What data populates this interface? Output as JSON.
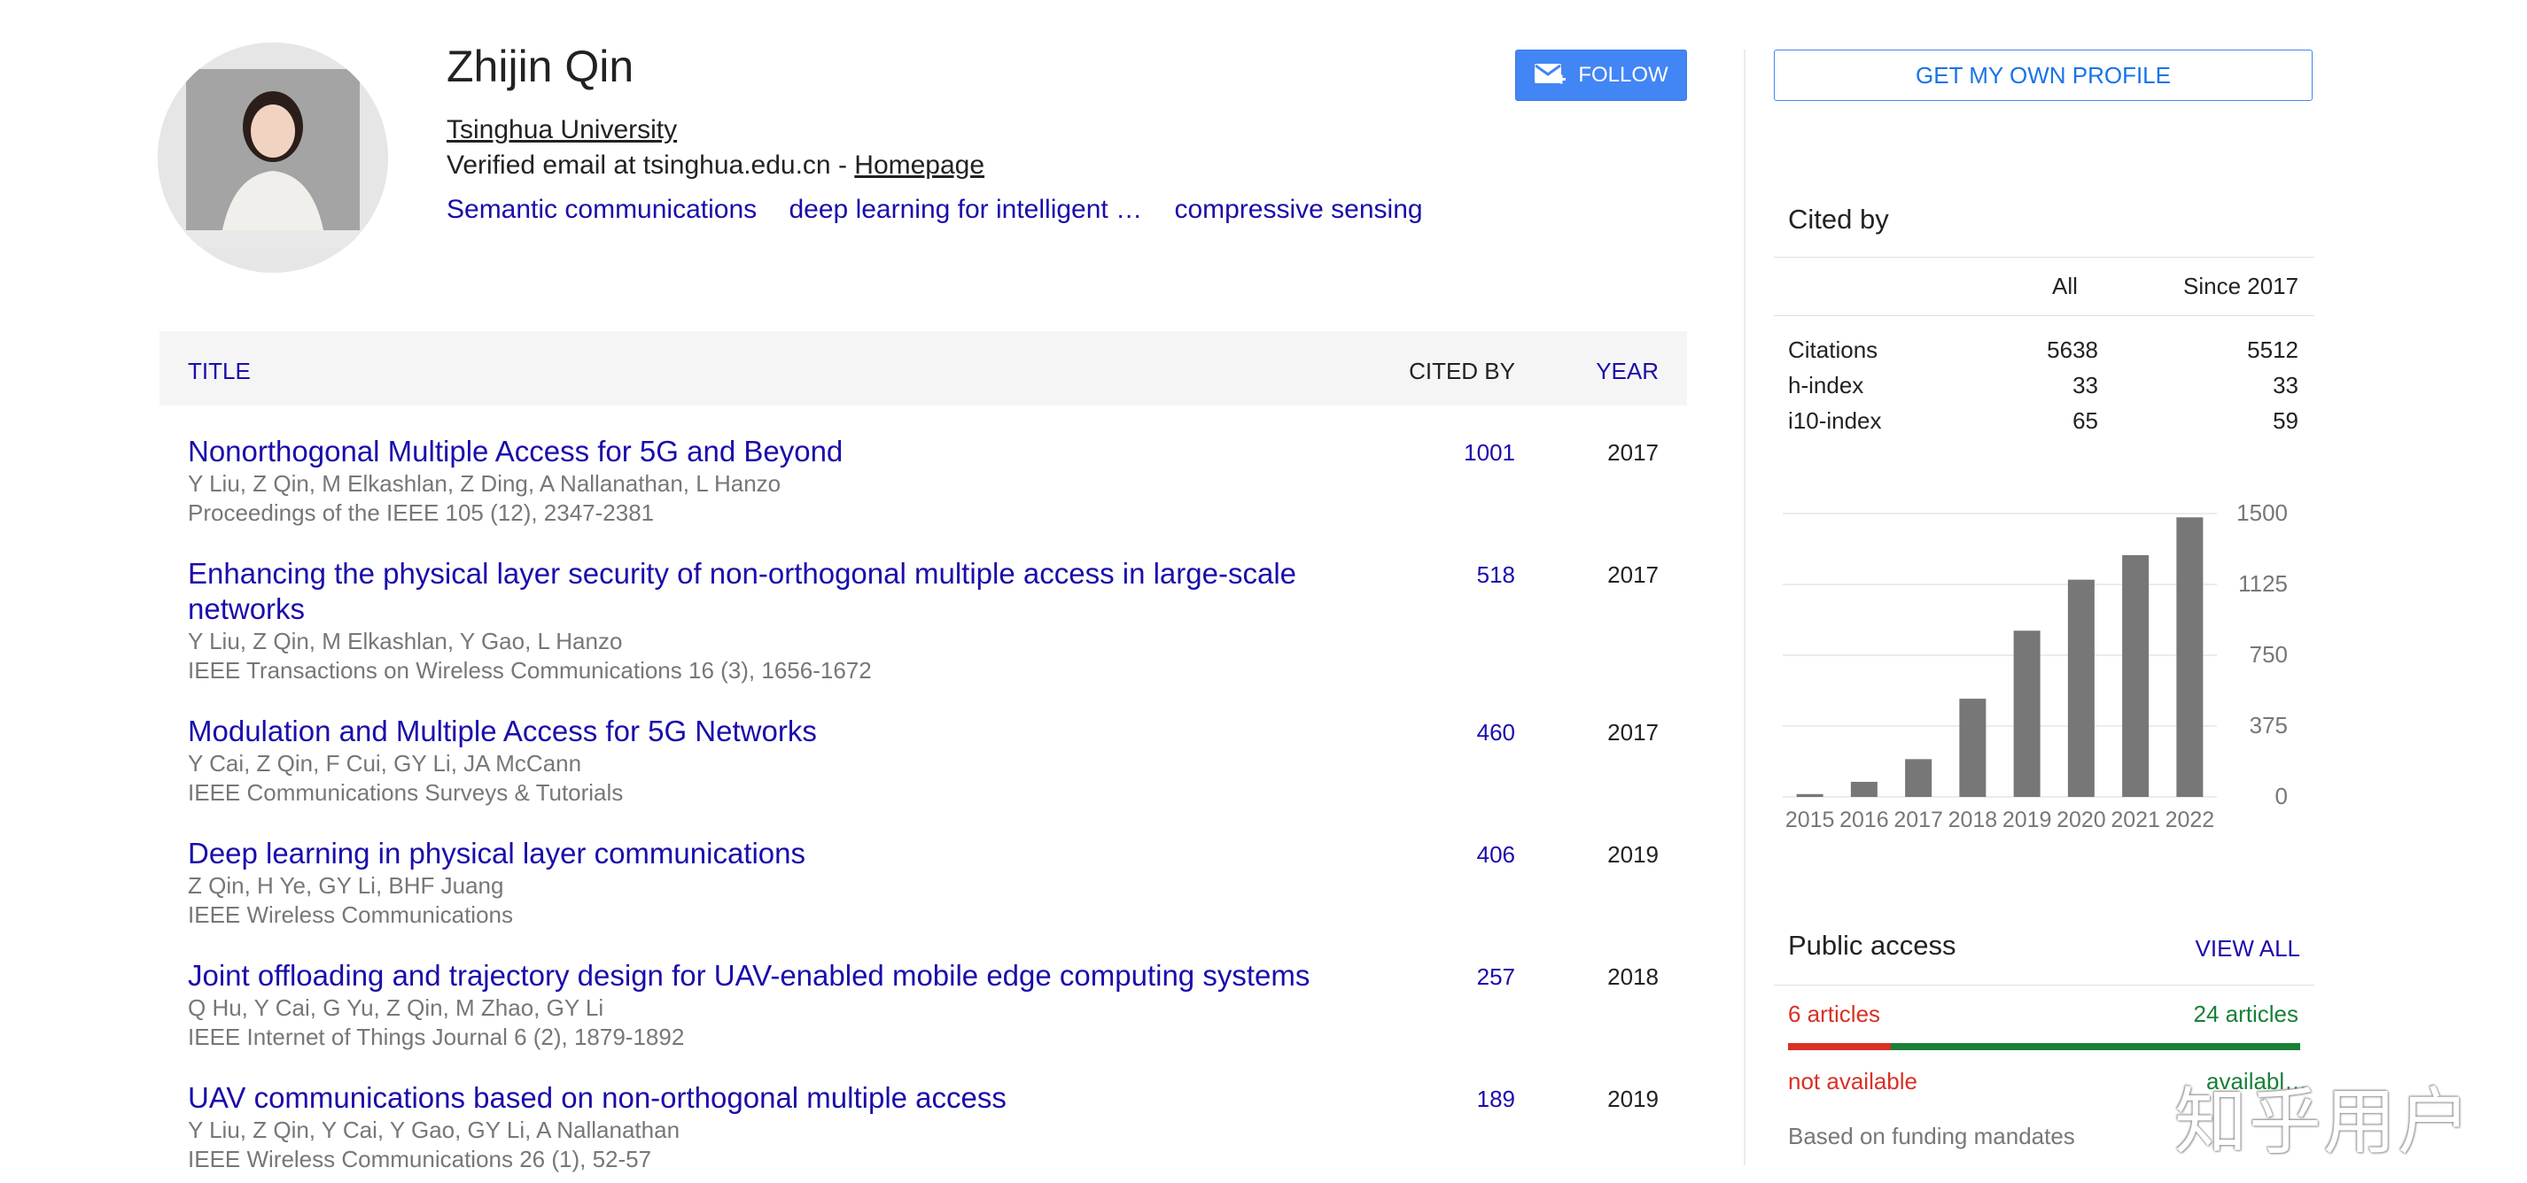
{
  "profile": {
    "name": "Zhijin Qin",
    "affiliation": "Tsinghua University",
    "email_prefix": "Verified email at tsinghua.edu.cn - ",
    "homepage": "Homepage",
    "interests": [
      "Semantic communications",
      "deep learning for intelligent …",
      "compressive sensing"
    ],
    "follow_label": "FOLLOW"
  },
  "table": {
    "col_title": "TITLE",
    "col_cited": "CITED BY",
    "col_year": "YEAR",
    "rows": [
      {
        "title": "Nonorthogonal Multiple Access for 5G and Beyond",
        "authors": "Y Liu, Z Qin, M Elkashlan, Z Ding, A Nallanathan, L Hanzo",
        "venue": "Proceedings of the IEEE 105 (12), 2347-2381",
        "cited": "1001",
        "year": "2017"
      },
      {
        "title": "Enhancing the physical layer security of non-orthogonal multiple access in large-scale networks",
        "authors": "Y Liu, Z Qin, M Elkashlan, Y Gao, L Hanzo",
        "venue": "IEEE Transactions on Wireless Communications 16 (3), 1656-1672",
        "cited": "518",
        "year": "2017"
      },
      {
        "title": "Modulation and Multiple Access for 5G Networks",
        "authors": "Y Cai, Z Qin, F Cui, GY Li, JA McCann",
        "venue": "IEEE Communications Surveys & Tutorials",
        "cited": "460",
        "year": "2017"
      },
      {
        "title": "Deep learning in physical layer communications",
        "authors": "Z Qin, H Ye, GY Li, BHF Juang",
        "venue": "IEEE Wireless Communications",
        "cited": "406",
        "year": "2019"
      },
      {
        "title": "Joint offloading and trajectory design for UAV-enabled mobile edge computing systems",
        "authors": "Q Hu, Y Cai, G Yu, Z Qin, M Zhao, GY Li",
        "venue": "IEEE Internet of Things Journal 6 (2), 1879-1892",
        "cited": "257",
        "year": "2018"
      },
      {
        "title": "UAV communications based on non-orthogonal multiple access",
        "authors": "Y Liu, Z Qin, Y Cai, Y Gao, GY Li, A Nallanathan",
        "venue": "IEEE Wireless Communications 26 (1), 52-57",
        "cited": "189",
        "year": "2019"
      }
    ]
  },
  "sidebar": {
    "get_profile": "GET MY OWN PROFILE",
    "cited_by": "Cited by",
    "col_all": "All",
    "col_since": "Since 2017",
    "stats": [
      {
        "label": "Citations",
        "all": "5638",
        "since": "5512"
      },
      {
        "label": "h-index",
        "all": "33",
        "since": "33"
      },
      {
        "label": "i10-index",
        "all": "65",
        "since": "59"
      }
    ],
    "public_access": {
      "title": "Public access",
      "view_all": "VIEW ALL",
      "left": "6 articles",
      "right": "24 articles",
      "not_available": "not available",
      "available": "availabl…",
      "funding": "Based on funding mandates",
      "available_fraction": 0.8
    }
  },
  "chart_data": {
    "type": "bar",
    "categories": [
      "2015",
      "2016",
      "2017",
      "2018",
      "2019",
      "2020",
      "2021",
      "2022"
    ],
    "values": [
      15,
      80,
      200,
      520,
      880,
      1150,
      1280,
      1480
    ],
    "ylim": [
      0,
      1500
    ],
    "yticks": [
      "1500",
      "1125",
      "750",
      "375",
      "0"
    ],
    "grid": true,
    "bar_color": "#777777"
  },
  "watermark": "知乎用户"
}
